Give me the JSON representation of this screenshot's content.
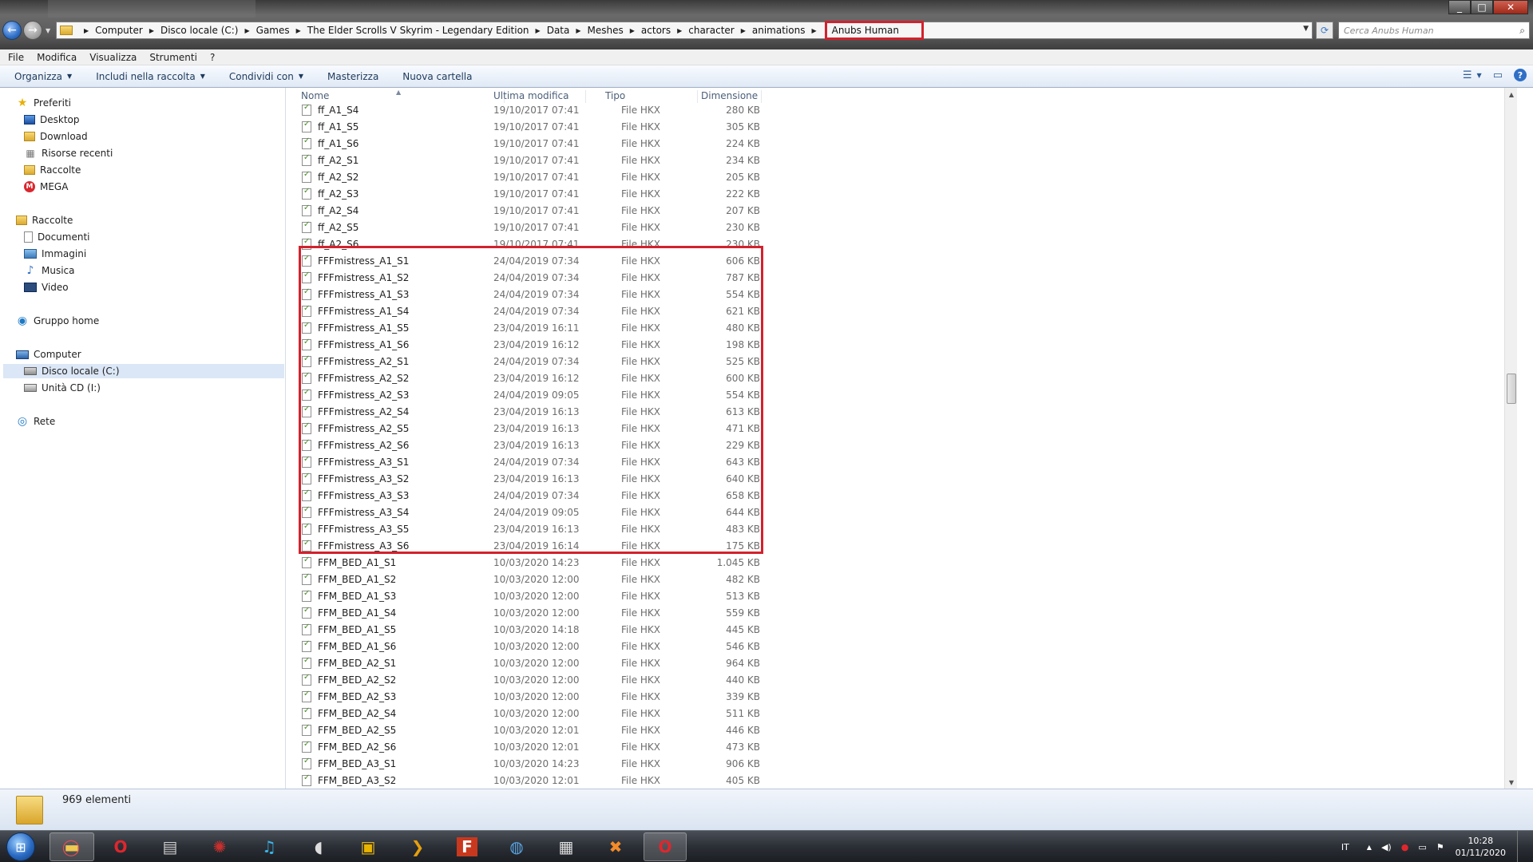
{
  "window": {
    "controls": [
      "_",
      "□",
      "✕"
    ]
  },
  "address": {
    "breadcrumbs": [
      "Computer",
      "Disco locale (C:)",
      "Games",
      "The Elder Scrolls V Skyrim - Legendary Edition",
      "Data",
      "Meshes",
      "actors",
      "character",
      "animations"
    ],
    "current": "Anubs Human",
    "search_placeholder": "Cerca Anubs Human"
  },
  "menubar": [
    "File",
    "Modifica",
    "Visualizza",
    "Strumenti",
    "?"
  ],
  "toolbar": {
    "organizza": "Organizza",
    "includi": "Includi nella raccolta",
    "condividi": "Condividi con",
    "masterizza": "Masterizza",
    "nuova_cartella": "Nuova cartella"
  },
  "navpane": {
    "preferiti": "Preferiti",
    "desktop": "Desktop",
    "download": "Download",
    "risorse_recenti": "Risorse recenti",
    "raccolte_fav": "Raccolte",
    "mega": "MEGA",
    "raccolte": "Raccolte",
    "documenti": "Documenti",
    "immagini": "Immagini",
    "musica": "Musica",
    "video": "Video",
    "gruppo_home": "Gruppo home",
    "computer": "Computer",
    "disco_locale": "Disco locale (C:)",
    "unita_cd": "Unità CD (I:)",
    "rete": "Rete"
  },
  "columns": {
    "name": "Nome",
    "modified": "Ultima modifica",
    "type": "Tipo",
    "size": "Dimensione"
  },
  "files": [
    {
      "name": "ff_A1_S4",
      "date": "19/10/2017 07:41",
      "type": "File HKX",
      "size": "280 KB"
    },
    {
      "name": "ff_A1_S5",
      "date": "19/10/2017 07:41",
      "type": "File HKX",
      "size": "305 KB"
    },
    {
      "name": "ff_A1_S6",
      "date": "19/10/2017 07:41",
      "type": "File HKX",
      "size": "224 KB"
    },
    {
      "name": "ff_A2_S1",
      "date": "19/10/2017 07:41",
      "type": "File HKX",
      "size": "234 KB"
    },
    {
      "name": "ff_A2_S2",
      "date": "19/10/2017 07:41",
      "type": "File HKX",
      "size": "205 KB"
    },
    {
      "name": "ff_A2_S3",
      "date": "19/10/2017 07:41",
      "type": "File HKX",
      "size": "222 KB"
    },
    {
      "name": "ff_A2_S4",
      "date": "19/10/2017 07:41",
      "type": "File HKX",
      "size": "207 KB"
    },
    {
      "name": "ff_A2_S5",
      "date": "19/10/2017 07:41",
      "type": "File HKX",
      "size": "230 KB"
    },
    {
      "name": "ff_A2_S6",
      "date": "19/10/2017 07:41",
      "type": "File HKX",
      "size": "230 KB"
    },
    {
      "name": "FFFmistress_A1_S1",
      "date": "24/04/2019 07:34",
      "type": "File HKX",
      "size": "606 KB"
    },
    {
      "name": "FFFmistress_A1_S2",
      "date": "24/04/2019 07:34",
      "type": "File HKX",
      "size": "787 KB"
    },
    {
      "name": "FFFmistress_A1_S3",
      "date": "24/04/2019 07:34",
      "type": "File HKX",
      "size": "554 KB"
    },
    {
      "name": "FFFmistress_A1_S4",
      "date": "24/04/2019 07:34",
      "type": "File HKX",
      "size": "621 KB"
    },
    {
      "name": "FFFmistress_A1_S5",
      "date": "23/04/2019 16:11",
      "type": "File HKX",
      "size": "480 KB"
    },
    {
      "name": "FFFmistress_A1_S6",
      "date": "23/04/2019 16:12",
      "type": "File HKX",
      "size": "198 KB"
    },
    {
      "name": "FFFmistress_A2_S1",
      "date": "24/04/2019 07:34",
      "type": "File HKX",
      "size": "525 KB"
    },
    {
      "name": "FFFmistress_A2_S2",
      "date": "23/04/2019 16:12",
      "type": "File HKX",
      "size": "600 KB"
    },
    {
      "name": "FFFmistress_A2_S3",
      "date": "24/04/2019 09:05",
      "type": "File HKX",
      "size": "554 KB"
    },
    {
      "name": "FFFmistress_A2_S4",
      "date": "23/04/2019 16:13",
      "type": "File HKX",
      "size": "613 KB"
    },
    {
      "name": "FFFmistress_A2_S5",
      "date": "23/04/2019 16:13",
      "type": "File HKX",
      "size": "471 KB"
    },
    {
      "name": "FFFmistress_A2_S6",
      "date": "23/04/2019 16:13",
      "type": "File HKX",
      "size": "229 KB"
    },
    {
      "name": "FFFmistress_A3_S1",
      "date": "24/04/2019 07:34",
      "type": "File HKX",
      "size": "643 KB"
    },
    {
      "name": "FFFmistress_A3_S2",
      "date": "23/04/2019 16:13",
      "type": "File HKX",
      "size": "640 KB"
    },
    {
      "name": "FFFmistress_A3_S3",
      "date": "24/04/2019 07:34",
      "type": "File HKX",
      "size": "658 KB"
    },
    {
      "name": "FFFmistress_A3_S4",
      "date": "24/04/2019 09:05",
      "type": "File HKX",
      "size": "644 KB"
    },
    {
      "name": "FFFmistress_A3_S5",
      "date": "23/04/2019 16:13",
      "type": "File HKX",
      "size": "483 KB"
    },
    {
      "name": "FFFmistress_A3_S6",
      "date": "23/04/2019 16:14",
      "type": "File HKX",
      "size": "175 KB"
    },
    {
      "name": "FFM_BED_A1_S1",
      "date": "10/03/2020 14:23",
      "type": "File HKX",
      "size": "1.045 KB"
    },
    {
      "name": "FFM_BED_A1_S2",
      "date": "10/03/2020 12:00",
      "type": "File HKX",
      "size": "482 KB"
    },
    {
      "name": "FFM_BED_A1_S3",
      "date": "10/03/2020 12:00",
      "type": "File HKX",
      "size": "513 KB"
    },
    {
      "name": "FFM_BED_A1_S4",
      "date": "10/03/2020 12:00",
      "type": "File HKX",
      "size": "559 KB"
    },
    {
      "name": "FFM_BED_A1_S5",
      "date": "10/03/2020 14:18",
      "type": "File HKX",
      "size": "445 KB"
    },
    {
      "name": "FFM_BED_A1_S6",
      "date": "10/03/2020 12:00",
      "type": "File HKX",
      "size": "546 KB"
    },
    {
      "name": "FFM_BED_A2_S1",
      "date": "10/03/2020 12:00",
      "type": "File HKX",
      "size": "964 KB"
    },
    {
      "name": "FFM_BED_A2_S2",
      "date": "10/03/2020 12:00",
      "type": "File HKX",
      "size": "440 KB"
    },
    {
      "name": "FFM_BED_A2_S3",
      "date": "10/03/2020 12:00",
      "type": "File HKX",
      "size": "339 KB"
    },
    {
      "name": "FFM_BED_A2_S4",
      "date": "10/03/2020 12:00",
      "type": "File HKX",
      "size": "511 KB"
    },
    {
      "name": "FFM_BED_A2_S5",
      "date": "10/03/2020 12:01",
      "type": "File HKX",
      "size": "446 KB"
    },
    {
      "name": "FFM_BED_A2_S6",
      "date": "10/03/2020 12:01",
      "type": "File HKX",
      "size": "473 KB"
    },
    {
      "name": "FFM_BED_A3_S1",
      "date": "10/03/2020 14:23",
      "type": "File HKX",
      "size": "906 KB"
    },
    {
      "name": "FFM_BED_A3_S2",
      "date": "10/03/2020 12:01",
      "type": "File HKX",
      "size": "405 KB"
    }
  ],
  "status": {
    "count": "969 elementi"
  },
  "tray": {
    "lang": "IT",
    "time": "10:28",
    "date": "01/11/2020"
  },
  "colors": {
    "highlight": "#d2222d",
    "accent": "#2f6fc6"
  }
}
